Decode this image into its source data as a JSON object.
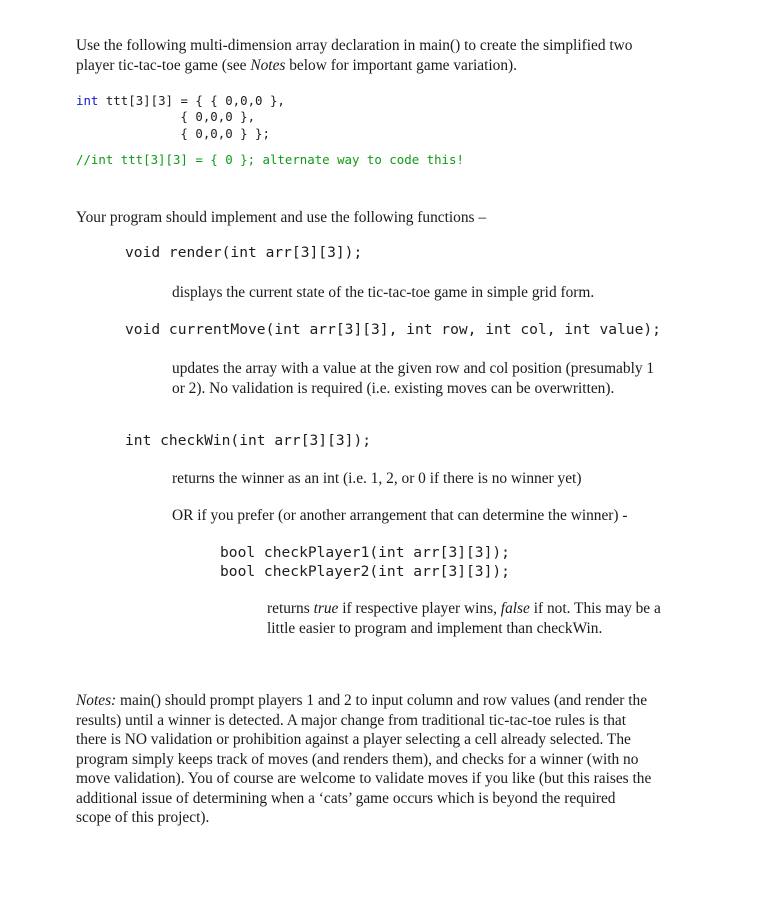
{
  "document": {
    "type": "programming-assignment-page",
    "intro": {
      "line1": "Use the following multi-dimension array declaration in main() to create the simplified",
      "line2_before": "two player tic-tac-toe game (see ",
      "line2_italic": "Notes",
      "line2_after": " below for important game variation)."
    },
    "code_declaration": {
      "keyword": "int",
      "rest_line1": " ttt[3][3] = { { 0,0,0 },",
      "line2": "              { 0,0,0 },",
      "line3": "              { 0,0,0 } };",
      "comment": "//int ttt[3][3] = { 0 }; alternate way to code this!"
    },
    "implement_line": "Your program should implement and use the following functions –",
    "functions": [
      {
        "signature": "void render(int arr[3][3]);",
        "description": "displays the current state of the tic-tac-toe game in simple grid form."
      },
      {
        "signature": "void currentMove(int arr[3][3], int row, int col, int value);",
        "description": "updates the array with a value at the given row and col position (presumably 1 or 2).  No validation is required (i.e. existing moves can be overwritten)."
      },
      {
        "signature": "int checkWin(int arr[3][3]);",
        "description": "returns the winner as an int (i.e. 1, 2, or 0 if there is no winner yet)",
        "alternative_intro": "OR if you prefer (or another arrangement that can determine the winner) -",
        "alt_signature_line1": "bool checkPlayer1(int arr[3][3]);",
        "alt_signature_line2": "bool checkPlayer2(int arr[3][3]);",
        "alt_description_before": "returns ",
        "alt_description_true": "true",
        "alt_description_mid": " if respective player wins, ",
        "alt_description_false": "false",
        "alt_description_after": " if not.  This may be a little easier to program and implement than checkWin."
      }
    ],
    "notes": {
      "label": "Notes:",
      "body": "  main() should prompt players 1 and 2 to input column and row values (and render the results) until a winner is detected.  A major change from traditional tic-tac-toe rules is that there is NO validation or prohibition against a player selecting a cell already selected.  The program simply keeps track of moves (and renders them), and checks for a winner (with no move validation).  You of course are welcome to validate moves if you like (but this raises the additional issue of determining when a ‘cats’ game occurs which is beyond the required scope of this project)."
    },
    "colors": {
      "keyword": "#0e18c8",
      "comment": "#0d9b16",
      "text": "#1a1a1a",
      "background": "#ffffff"
    }
  }
}
